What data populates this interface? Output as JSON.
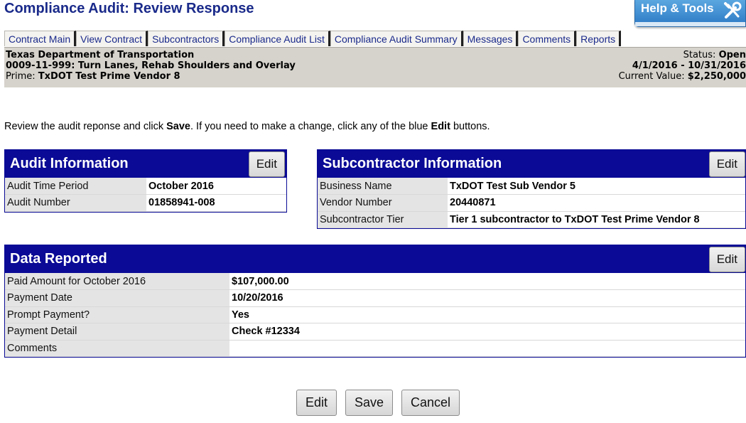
{
  "page": {
    "title": "Compliance Audit: Review Response"
  },
  "help": {
    "label": "Help & Tools",
    "icon": "tools-icon"
  },
  "tabs": [
    "Contract Main",
    "View Contract",
    "Subcontractors",
    "Compliance Audit List",
    "Compliance Audit Summary",
    "Messages",
    "Comments",
    "Reports"
  ],
  "contract": {
    "agency": "Texas Department of Transportation",
    "project": "0009-11-999: Turn Lanes, Rehab Shoulders and Overlay",
    "prime_label": "Prime:",
    "prime_value": "TxDOT Test Prime Vendor 8",
    "status_label": "Status:",
    "status_value": "Open",
    "dates": "4/1/2016 - 10/31/2016",
    "value_label": "Current Value:",
    "value_value": "$2,250,000"
  },
  "instructions": {
    "part1": "Review the audit reponse and click ",
    "save_word": "Save",
    "part2": ". If you need to make a change, click any of the blue ",
    "edit_word": "Edit",
    "part3": " buttons."
  },
  "audit_info": {
    "title": "Audit Information",
    "edit_label": "Edit",
    "rows": [
      {
        "label": "Audit Time Period",
        "value": "October 2016"
      },
      {
        "label": "Audit Number",
        "value": "01858941-008"
      }
    ]
  },
  "sub_info": {
    "title": "Subcontractor Information",
    "edit_label": "Edit",
    "rows": [
      {
        "label": "Business Name",
        "value": "TxDOT Test Sub Vendor 5"
      },
      {
        "label": "Vendor Number",
        "value": "20440871"
      },
      {
        "label": "Subcontractor Tier",
        "value": "Tier 1 subcontractor to TxDOT Test Prime Vendor 8"
      }
    ]
  },
  "data_reported": {
    "title": "Data Reported",
    "edit_label": "Edit",
    "rows": [
      {
        "label": "Paid Amount for October 2016",
        "value": "$107,000.00"
      },
      {
        "label": "Payment Date",
        "value": "10/20/2016"
      },
      {
        "label": "Prompt Payment?",
        "value": "Yes"
      },
      {
        "label": "Payment Detail",
        "value": "Check #12334"
      },
      {
        "label": "Comments",
        "value": ""
      }
    ]
  },
  "buttons": {
    "edit": "Edit",
    "save": "Save",
    "cancel": "Cancel"
  }
}
